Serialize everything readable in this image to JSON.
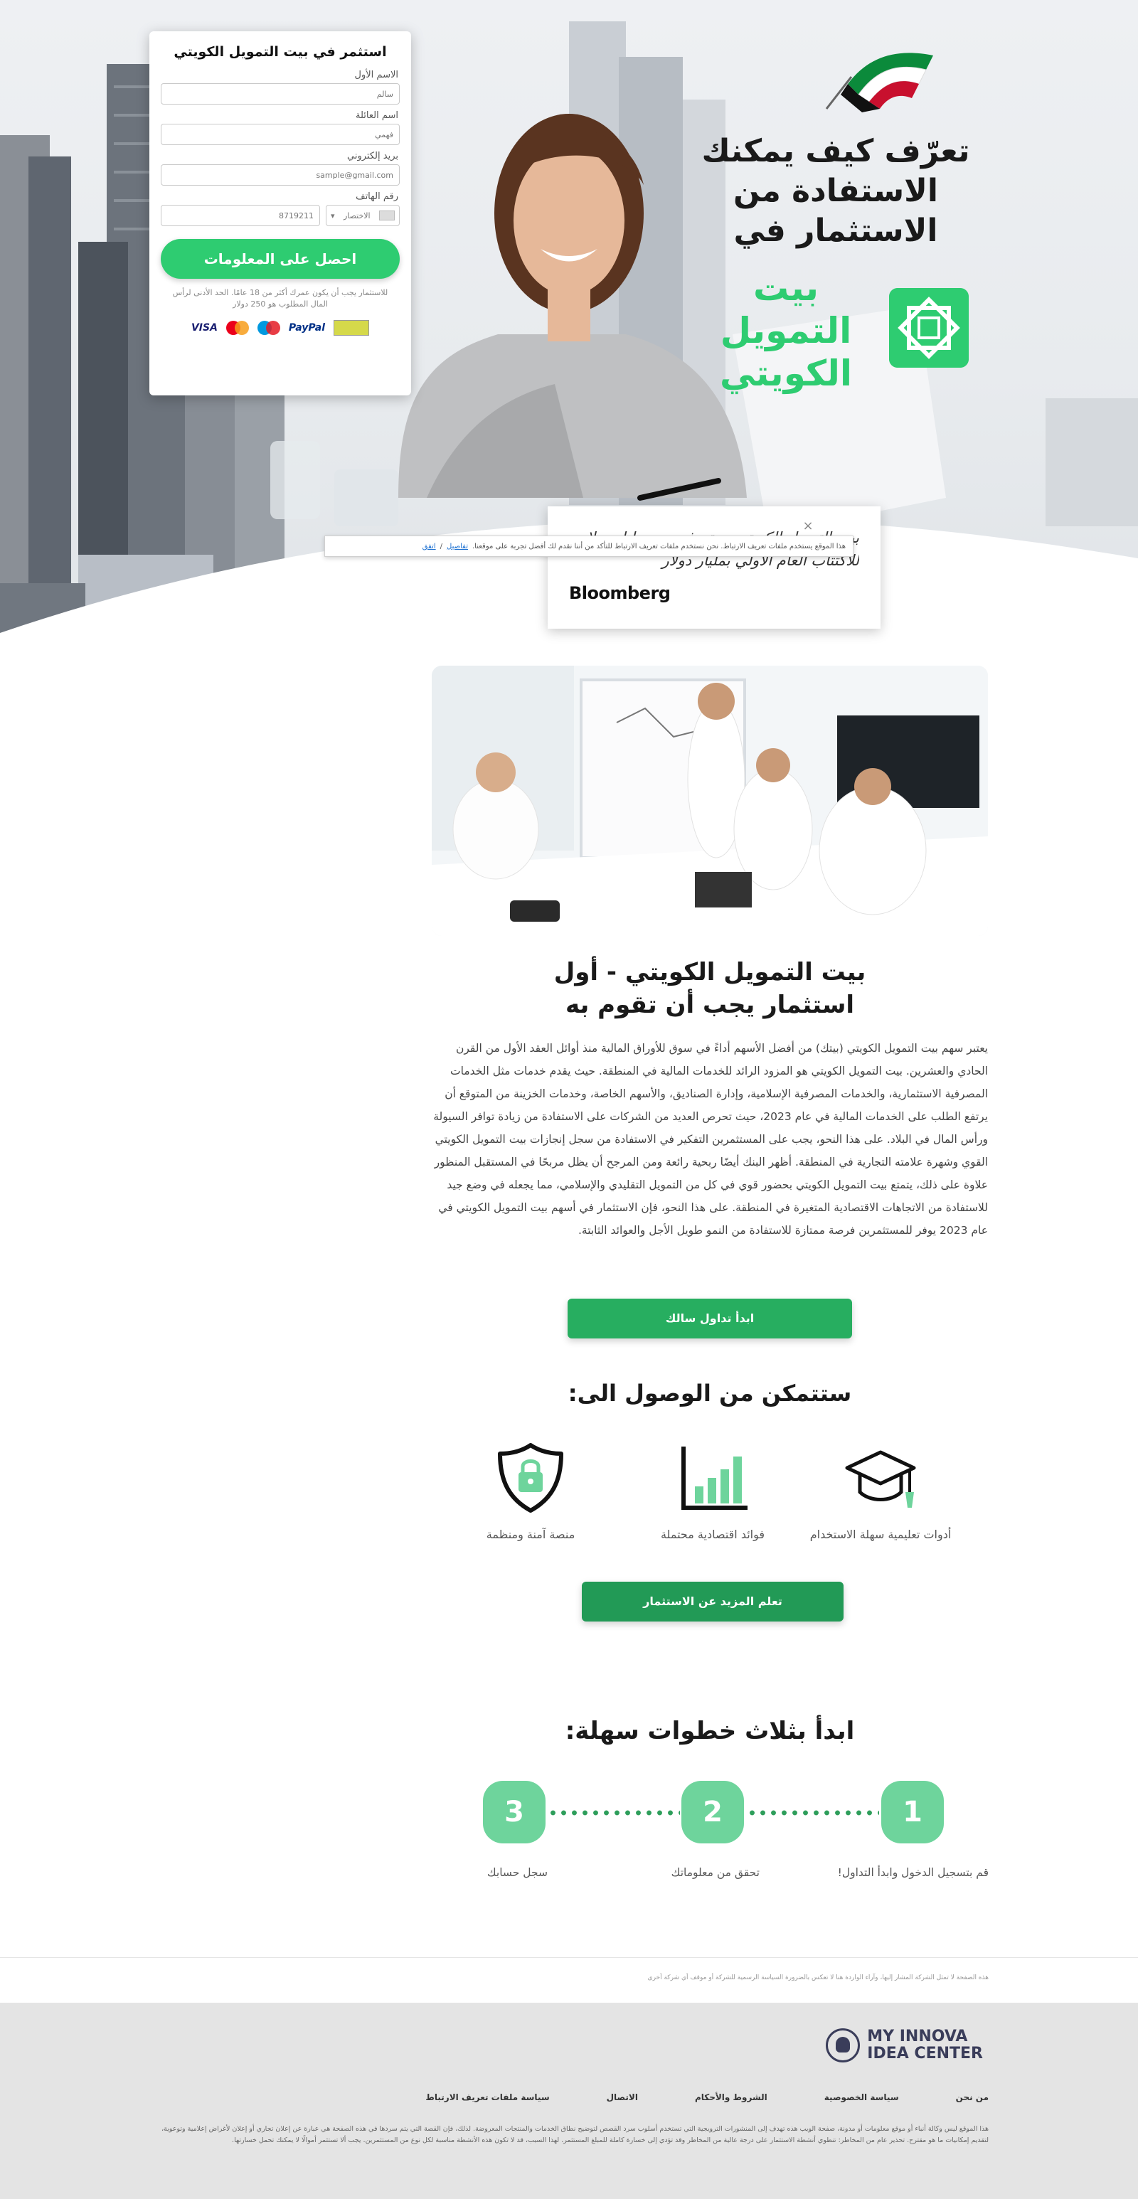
{
  "hero": {
    "title_lines": [
      "تعرّف كيف يمكنك",
      "الاستفادة من",
      "الاستثمار في"
    ],
    "brand_lines": [
      "بيت",
      "التمويل",
      "الكويتي"
    ]
  },
  "form": {
    "title": "استثمر في بيت التمويل الكويتي",
    "first_name_label": "الاسم الأول",
    "first_name_placeholder": "سالم",
    "last_name_label": "اسم العائلة",
    "last_name_placeholder": "فهمي",
    "email_label": "بريد إلكتروني",
    "email_placeholder": "sample@gmail.com",
    "phone_label": "رقم الهاتف",
    "phone_placeholder": "8719211",
    "country_code": "الاختصار",
    "submit_label": "احصل على المعلومات",
    "note": "للاستثمار يجب أن يكون عمرك أكثر من 18 عامًا. الحد الأدنى لرأس المال المطلوب هو 250 دولار",
    "payments": [
      "VISA",
      "PayPal"
    ]
  },
  "quote": {
    "text": "بيت التمويل الكويتي يستهدف جمع مليار دولار للاكتتاب العام الأولي بمليار دولار",
    "source": "Bloomberg"
  },
  "cookie": {
    "text": "هذا الموقع يستخدم ملفات تعريف الارتباط. نحن نستخدم ملفات تعريف الارتباط للتأكد من أننا نقدم لك أفضل تجربة على موقعنا.",
    "more_link": "تفاصيل",
    "accept_link": "اتفق",
    "close": "×"
  },
  "section2": {
    "title_lines": [
      "بيت التمويل الكويتي - أول",
      "استثمار يجب أن تقوم به"
    ],
    "body": "يعتبر سهم بيت التمويل الكويتي (بيتك) من أفضل الأسهم أداءً في سوق للأوراق المالية منذ أوائل العقد الأول من القرن الحادي والعشرين. بيت التمويل الكويتي هو المزود الرائد للخدمات المالية في المنطقة. حيث يقدم خدمات مثل الخدمات المصرفية الاستثمارية، والخدمات المصرفية الإسلامية، وإدارة الصناديق، والأسهم الخاصة، وخدمات الخزينة من المتوقع أن يرتفع الطلب على الخدمات المالية في عام 2023، حيث تحرص العديد من الشركات على الاستفادة من زيادة توافر السيولة ورأس المال في البلاد. على هذا النحو، يجب على المستثمرين التفكير في الاستفادة من سجل إنجازات بيت التمويل الكويتي القوي وشهرة علامته التجارية في المنطقة. أظهر البنك أيضًا ربحية رائعة ومن المرجح أن يظل مربحًا في المستقبل المنظور علاوة على ذلك، يتمتع بيت التمويل الكويتي بحضور قوي في كل من التمويل التقليدي والإسلامي، مما يجعله في وضع جيد للاستفادة من الاتجاهات الاقتصادية المتغيرة في المنطقة. على هذا النحو، فإن الاستثمار في أسهم بيت التمويل الكويتي في عام 2023 يوفر للمستثمرين فرصة ممتازة للاستفادة من النمو طويل الأجل والعوائد الثابتة.",
    "cta": "ابدأ تداول سالك"
  },
  "section3": {
    "title": "ستتمكن من الوصول الى:",
    "features": [
      {
        "label": "أدوات تعليمية سهلة الاستخدام",
        "icon": "graduation-cap-icon"
      },
      {
        "label": "فوائد اقتصادية محتملة",
        "icon": "bar-chart-icon"
      },
      {
        "label": "منصة آمنة ومنظمة",
        "icon": "shield-lock-icon"
      }
    ],
    "cta": "تعلم المزيد عن الاستثمار"
  },
  "section4": {
    "title": "ابدأ بثلاث خطوات سهلة:",
    "steps": [
      {
        "num": "1",
        "label": "قم بتسجيل الدخول وابدأ التداول!"
      },
      {
        "num": "2",
        "label": "تحقق من معلوماتك"
      },
      {
        "num": "3",
        "label": "سجل حسابك"
      }
    ]
  },
  "footer": {
    "disclaimer_top": "هذه الصفحة لا تمثل الشركة المشار إليها، وآراء الواردة هنا لا تعكس بالضرورة السياسة الرسمية للشركة أو موقف أي شركة أخرى",
    "logo_line1": "MY INNOVA",
    "logo_line2": "IDEA CENTER",
    "nav": [
      "من نحن",
      "سياسة الخصوصية",
      "الشروط والأحكام",
      "الاتصال",
      "سياسة ملفات تعريف الارتباط"
    ],
    "note": "هذا الموقع ليس وكالة أنباء أو موقع معلومات أو مدونة، صفحة الويب هذه تهدف إلى المنشورات الترويجية التي تستخدم أسلوب سرد القصص لتوضيح نطاق الخدمات والمنتجات المعروضة. لذلك، فإن القصة التي يتم سردها في هذه الصفحة هي عبارة عن إعلان تجاري أو إعلان لأغراض إعلامية وتوعوية، لتقديم إمكانيات ما هو مقترح. تحذير عام من المخاطر: تنطوي أنشطة الاستثمار على درجة عالية من المخاطر وقد تؤدي إلى خسارة كاملة للمبلغ المستثمر. لهذا السبب، قد لا تكون هذه الأنشطة مناسبة لكل نوع من المستثمرين. يجب ألا تستثمر أموالًا لا يمكنك تحمل خسارتها."
  },
  "colors": {
    "brand_green": "#2ecc71",
    "cta_green": "#27ae60",
    "step_green": "#6ed49c"
  }
}
